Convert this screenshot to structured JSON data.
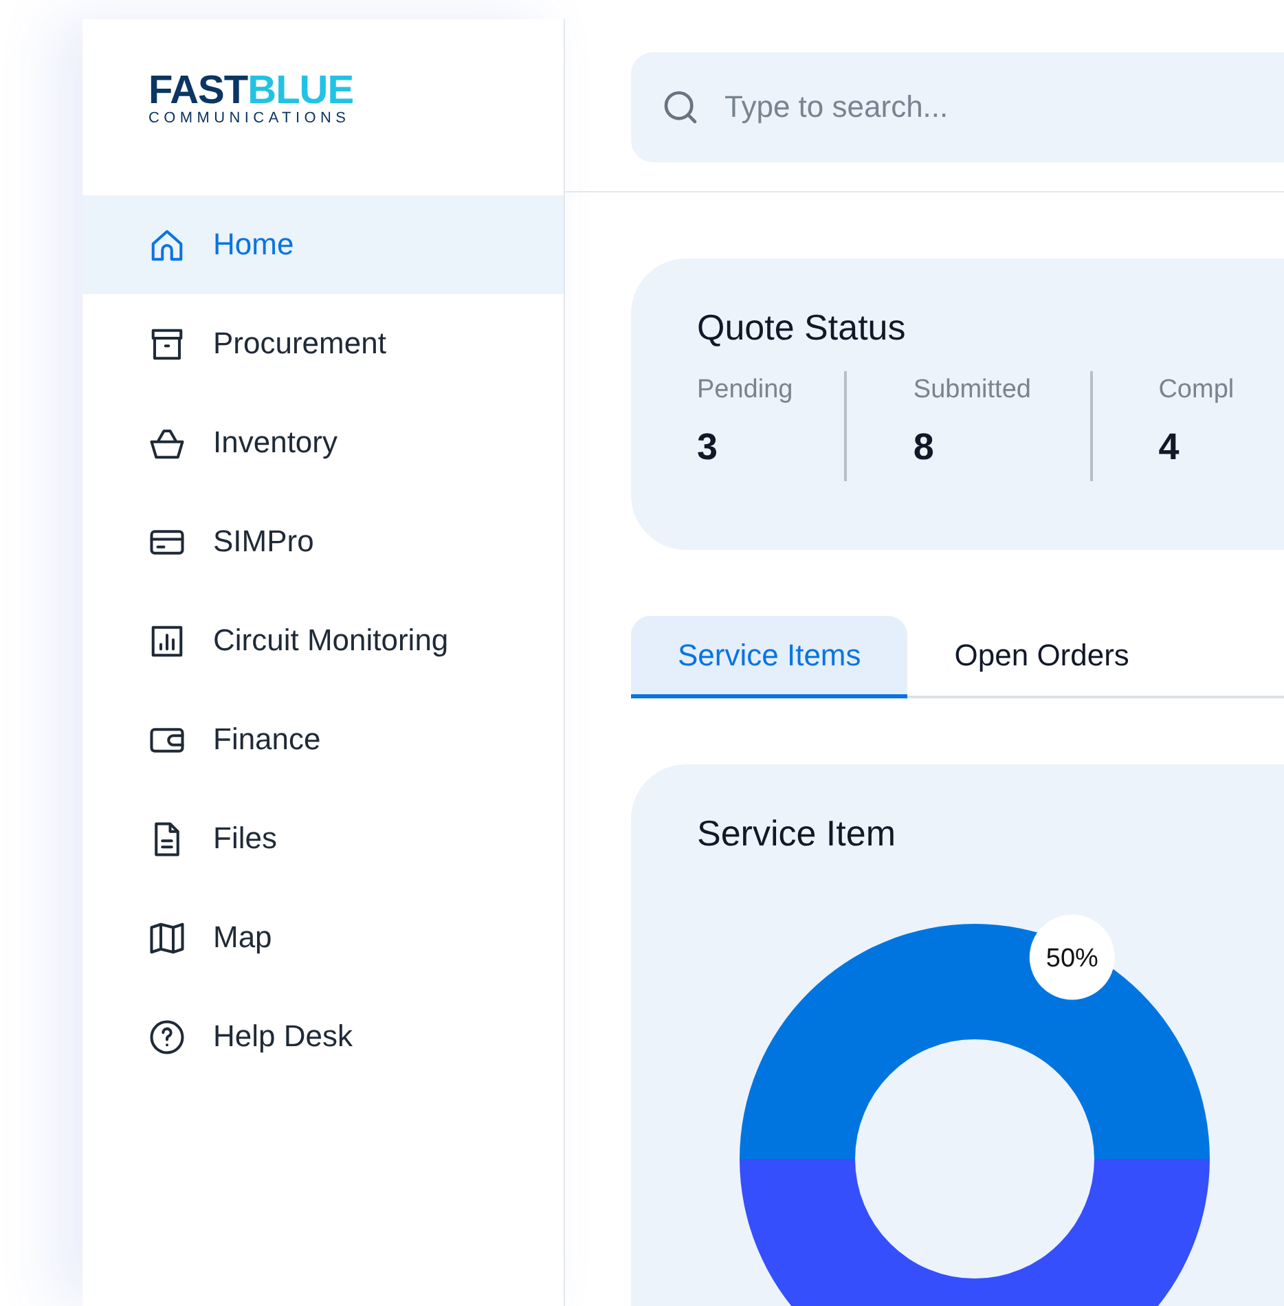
{
  "logo": {
    "brand_dark": "FAST",
    "brand_light": "BLUE",
    "tagline": "COMMUNICATIONS"
  },
  "sidebar": {
    "items": [
      {
        "label": "Home",
        "selected": true
      },
      {
        "label": "Procurement",
        "selected": false
      },
      {
        "label": "Inventory",
        "selected": false
      },
      {
        "label": "SIMPro",
        "selected": false
      },
      {
        "label": "Circuit Monitoring",
        "selected": false
      },
      {
        "label": "Finance",
        "selected": false
      },
      {
        "label": "Files",
        "selected": false
      },
      {
        "label": "Map",
        "selected": false
      },
      {
        "label": "Help Desk",
        "selected": false
      }
    ]
  },
  "search": {
    "placeholder": "Type to search..."
  },
  "quote_status": {
    "title": "Quote Status",
    "stats": [
      {
        "label": "Pending",
        "value": "3"
      },
      {
        "label": "Submitted",
        "value": "8"
      },
      {
        "label": "Compl",
        "value": "4"
      }
    ]
  },
  "tabs": [
    {
      "label": "Service Items",
      "selected": true
    },
    {
      "label": "Open Orders",
      "selected": false
    }
  ],
  "service_item": {
    "title": "Service Item",
    "chart_data": {
      "type": "donut",
      "values": [
        50,
        50
      ],
      "colors": [
        "#0075e0",
        "#354ffd"
      ],
      "value_labels": [
        "50%",
        null
      ]
    }
  }
}
